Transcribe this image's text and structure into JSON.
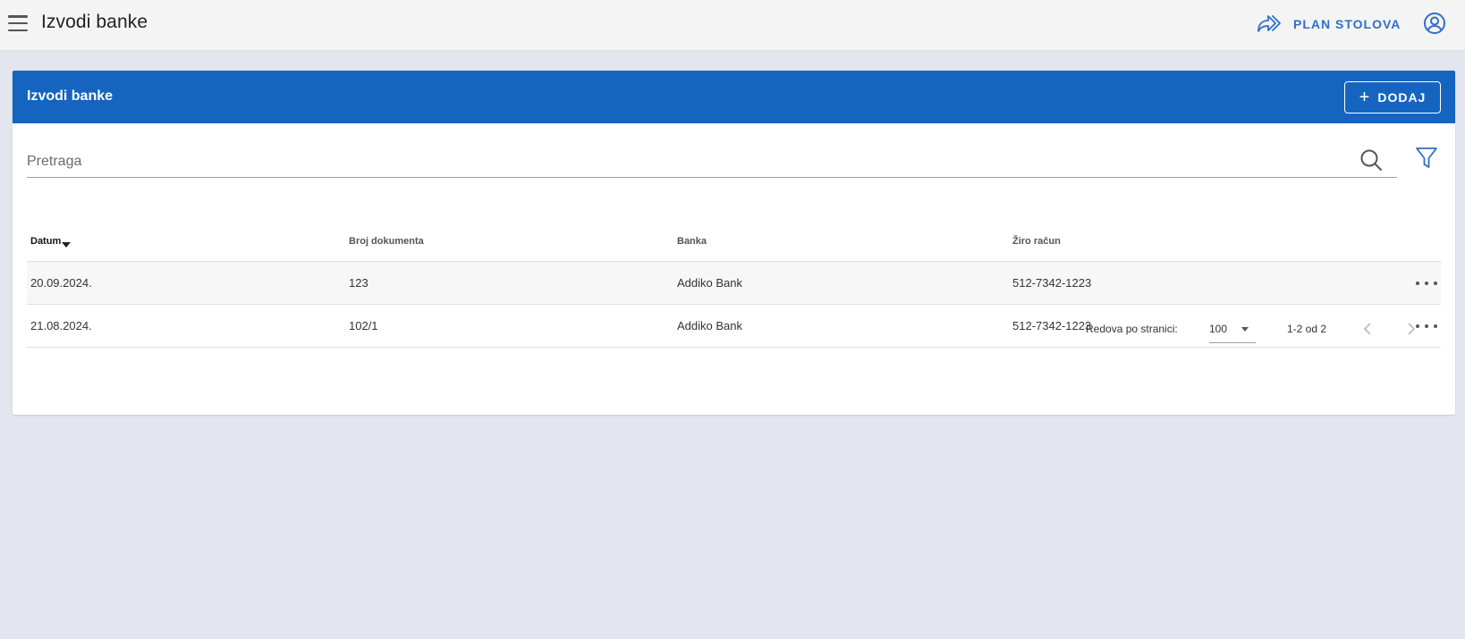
{
  "header": {
    "title": "Izvodi banke",
    "plan_label": "PLAN STOLOVA"
  },
  "card": {
    "title": "Izvodi banke",
    "add_label": "DODAJ"
  },
  "search": {
    "placeholder": "Pretraga"
  },
  "table": {
    "columns": [
      "Datum",
      "Broj dokumenta",
      "Banka",
      "Žiro račun"
    ],
    "sorted_column": "Datum",
    "rows": [
      {
        "datum": "20.09.2024.",
        "broj": "123",
        "banka": "Addiko Bank",
        "ziro": "512-7342-1223"
      },
      {
        "datum": "21.08.2024.",
        "broj": "102/1",
        "banka": "Addiko Bank",
        "ziro": "512-7342-1223"
      }
    ]
  },
  "pagination": {
    "rows_label": "Redova po stranici:",
    "rows_per_page": "100",
    "range": "1-2 od 2"
  },
  "colors": {
    "primary": "#1565c0",
    "accent": "#2f6fc6",
    "background": "#e3e6ee",
    "topbar": "#f4f4f4"
  },
  "icons": [
    "menu-icon",
    "plan-arrow-icon",
    "account-icon",
    "plus-icon",
    "search-icon",
    "filter-icon",
    "more-horizontal-icon",
    "chevron-left-icon",
    "chevron-right-icon"
  ]
}
